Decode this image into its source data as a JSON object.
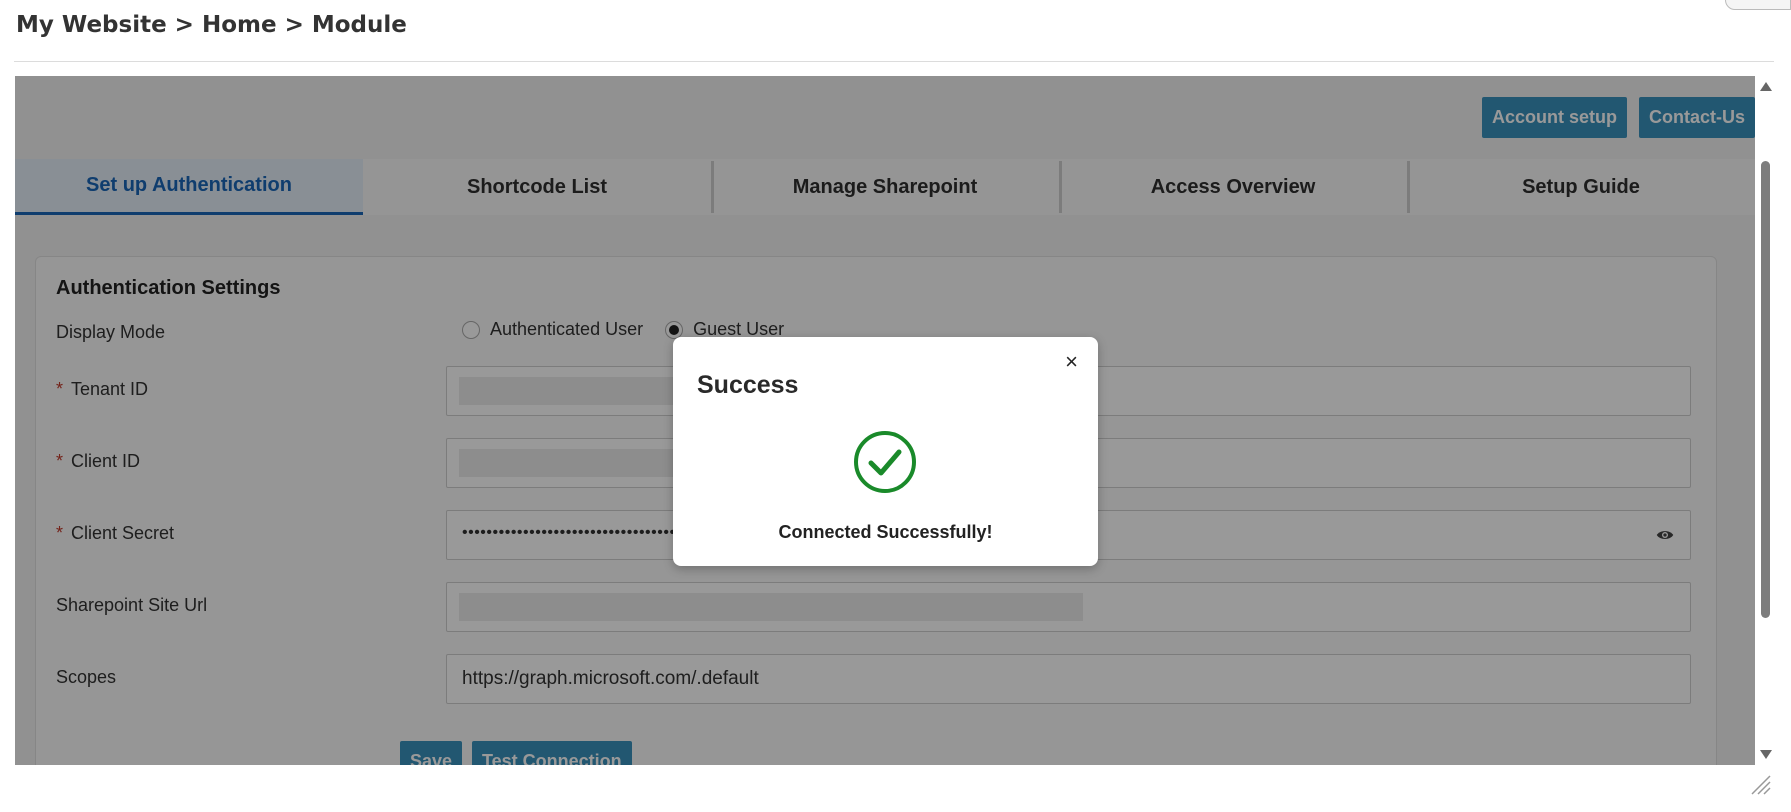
{
  "breadcrumb": "My Website > Home > Module",
  "header_buttons": {
    "account_setup": "Account setup",
    "contact_us": "Contact-Us"
  },
  "tabs": [
    {
      "label": "Set up Authentication",
      "active": true
    },
    {
      "label": "Shortcode List",
      "active": false
    },
    {
      "label": "Manage Sharepoint",
      "active": false
    },
    {
      "label": "Access Overview",
      "active": false
    },
    {
      "label": "Setup Guide",
      "active": false
    }
  ],
  "auth_settings": {
    "title": "Authentication Settings",
    "display_mode": {
      "label": "Display Mode",
      "options": [
        "Authenticated User",
        "Guest User"
      ],
      "selected": "Guest User"
    },
    "tenant_id": {
      "label": "Tenant ID",
      "required_mark": "*",
      "value": ""
    },
    "client_id": {
      "label": "Client ID",
      "required_mark": "*",
      "value": ""
    },
    "client_secret": {
      "label": "Client Secret",
      "required_mark": "*",
      "masked_value": "••••••••••••••••••••••••••••••••••••••••"
    },
    "sharepoint_site_url": {
      "label": "Sharepoint Site Url",
      "value": ""
    },
    "scopes": {
      "label": "Scopes",
      "value": "https://graph.microsoft.com/.default"
    },
    "save_label": "Save",
    "test_connection_label": "Test Connection"
  },
  "modal": {
    "title": "Success",
    "close_symbol": "×",
    "message": "Connected Successfully!",
    "icon": "check-circle-icon"
  },
  "colors": {
    "button_blue": "#3a92bd",
    "active_tab_text": "#1a66b8",
    "success_green": "#1a8a2a",
    "required_red": "#c0392b"
  }
}
